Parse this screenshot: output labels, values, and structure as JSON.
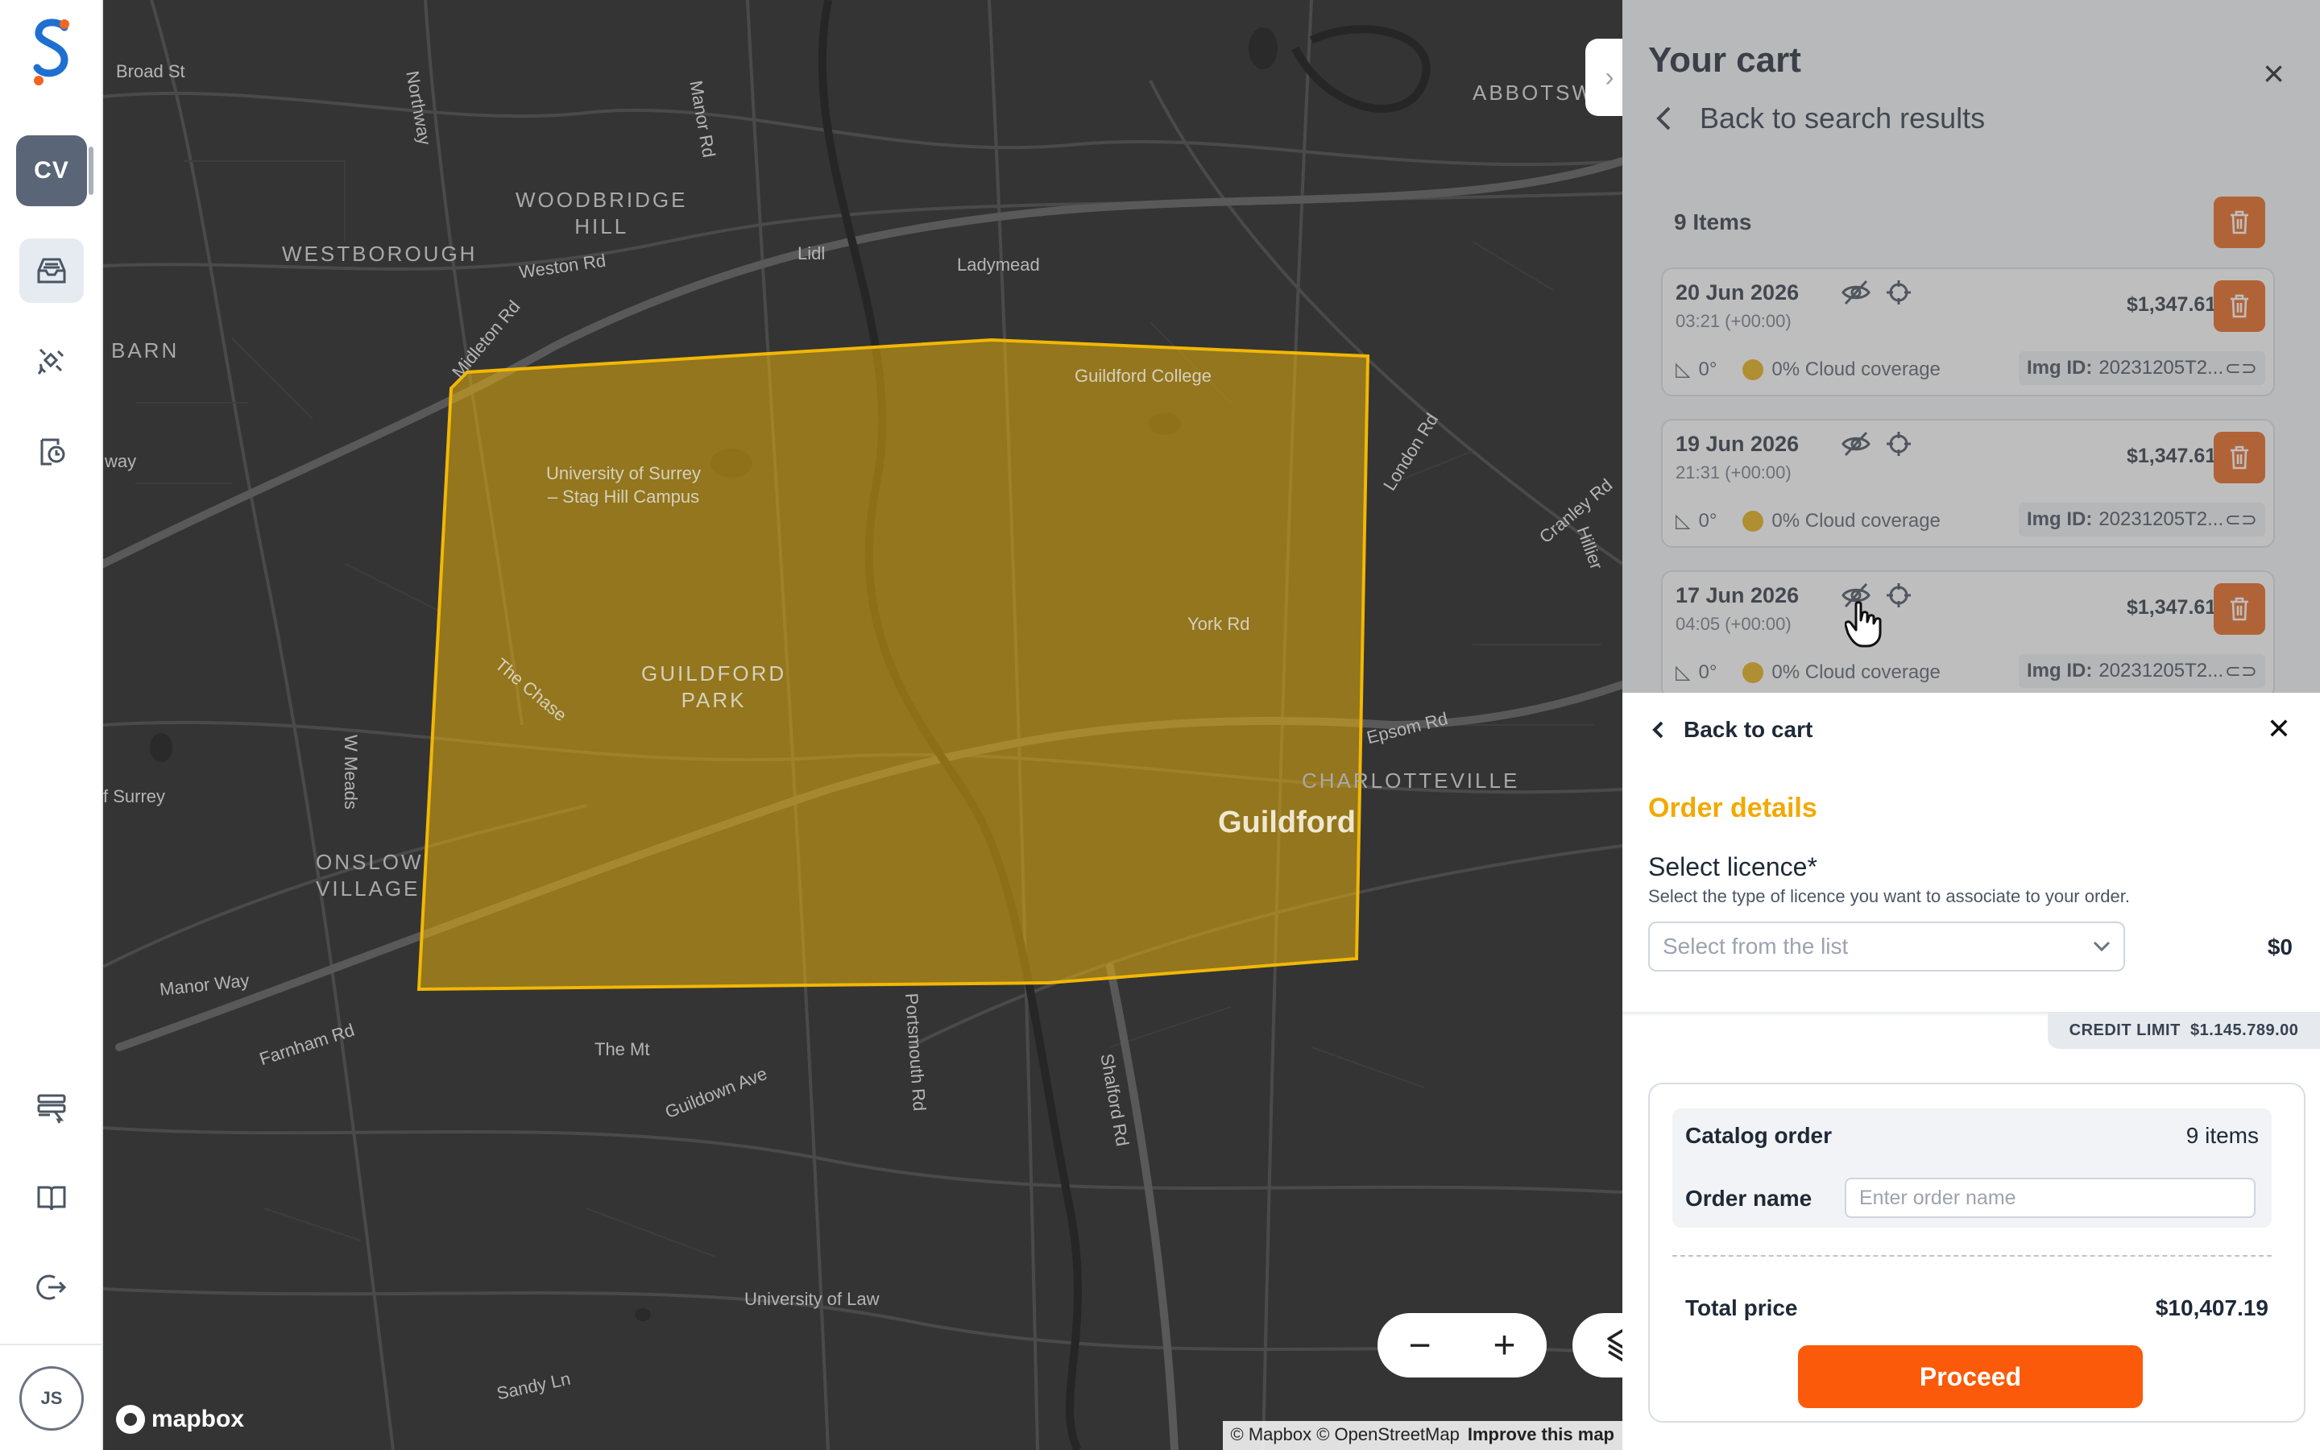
{
  "app": {
    "org_initials": "CV",
    "user_initials": "JS"
  },
  "map": {
    "labels": {
      "broad_st": "Broad St",
      "northway": "Northway",
      "manor_rd": "Manor Rd",
      "abbotswood": "ABBOTSW",
      "woodbridge_hill": "WOODBRIDGE\nHILL",
      "westborough": "WESTBOROUGH",
      "weston_rd": "Weston Rd",
      "lidl": "Lidl",
      "ladymead": "Ladymead",
      "barn": "BARN",
      "midleton_rd": "Midleton Rd",
      "guildford_college": "Guildford College",
      "surrey_campus": "University of Surrey\n– Stag Hill Campus",
      "london_rd": "London Rd",
      "cranley_rd": "Cranley Rd",
      "hillier": "Hillier",
      "way": "way",
      "york_rd": "York Rd",
      "the_chase": "The Chase",
      "guildford_park": "GUILDFORD\nPARK",
      "epsom_rd": "Epsom Rd",
      "charlotteville": "CHARLOTTEVILLE",
      "w_meads": "W Meads",
      "f_surrey": "f Surrey",
      "guildford": "Guildford",
      "onslow_village": "ONSLOW\nVILLAGE",
      "manor_way": "Manor Way",
      "farnham_rd": "Farnham Rd",
      "portsmouth_rd": "Portsmouth Rd",
      "shalford_rd": "Shalford Rd",
      "the_mt": "The Mt",
      "guildown_ave": "Guildown Ave",
      "university_of_law": "University of Law",
      "sandy_ln": "Sandy Ln"
    },
    "attribution": "© Mapbox © OpenStreetMap",
    "improve_link": "Improve this map",
    "mapbox_logo": "mapbox",
    "aoi_color": "#f2b705"
  },
  "cart": {
    "title": "Your cart",
    "back_label": "Back to search results",
    "items_label": "9 Items",
    "items": [
      {
        "date": "20 Jun 2026",
        "time": "03:21 (+00:00)",
        "price": "$1,347.61",
        "angle": "0°",
        "cloud": "0% Cloud coverage",
        "img_label": "Img ID:",
        "img_id": "20231205T2..."
      },
      {
        "date": "19 Jun 2026",
        "time": "21:31 (+00:00)",
        "price": "$1,347.61",
        "angle": "0°",
        "cloud": "0% Cloud coverage",
        "img_label": "Img ID:",
        "img_id": "20231205T2..."
      },
      {
        "date": "17 Jun 2026",
        "time": "04:05 (+00:00)",
        "price": "$1,347.61",
        "angle": "0°",
        "cloud": "0% Cloud coverage",
        "img_label": "Img ID:",
        "img_id": "20231205T2..."
      }
    ]
  },
  "order": {
    "back_label": "Back to cart",
    "heading": "Order details",
    "licence_title": "Select licence*",
    "licence_sub": "Select the type of licence you want to associate to your order.",
    "licence_placeholder": "Select from the list",
    "licence_price": "$0",
    "credit_label": "CREDIT LIMIT",
    "credit_value": "$1.145.789.00",
    "catalog_label": "Catalog order",
    "catalog_count": "9 items",
    "order_name_label": "Order name",
    "order_name_placeholder": "Enter order name",
    "total_label": "Total price",
    "total_value": "$10,407.19",
    "proceed_label": "Proceed"
  },
  "colors": {
    "accent_orange": "#fa5a0a",
    "heading_yellow": "#f2a900",
    "trash_orange": "#e8590c"
  }
}
